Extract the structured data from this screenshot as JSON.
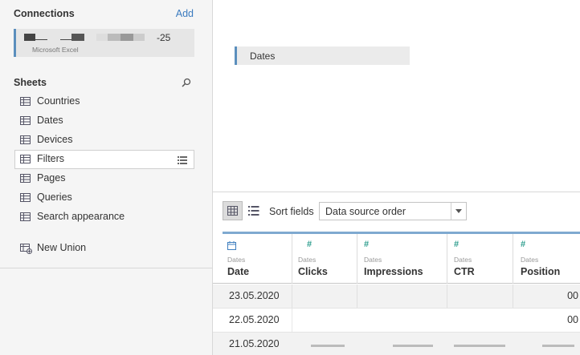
{
  "connections": {
    "title": "Connections",
    "add_label": "Add",
    "item": {
      "name_suffix": "-25",
      "type": "Microsoft Excel"
    }
  },
  "sheets": {
    "title": "Sheets",
    "items": [
      {
        "label": "Countries"
      },
      {
        "label": "Dates"
      },
      {
        "label": "Devices"
      },
      {
        "label": "Filters"
      },
      {
        "label": "Pages"
      },
      {
        "label": "Queries"
      },
      {
        "label": "Search appearance"
      }
    ],
    "new_union": "New Union"
  },
  "canvas": {
    "table_label": "Dates"
  },
  "toolbar": {
    "sort_label": "Sort fields",
    "sort_value": "Data source order"
  },
  "grid": {
    "columns": [
      {
        "source": "Dates",
        "name": "Date",
        "type": "date"
      },
      {
        "source": "Dates",
        "name": "Clicks",
        "type": "number"
      },
      {
        "source": "Dates",
        "name": "Impressions",
        "type": "number"
      },
      {
        "source": "Dates",
        "name": "CTR",
        "type": "number"
      },
      {
        "source": "Dates",
        "name": "Position",
        "type": "number"
      }
    ],
    "rows": [
      {
        "date": "23.05.2020",
        "position_tail": "00"
      },
      {
        "date": "22.05.2020",
        "position_tail": "00"
      },
      {
        "date": "21.05.2020",
        "position_tail": ""
      }
    ]
  },
  "colors": {
    "accent": "#5b8fbd",
    "link": "#3b7bbf",
    "number_icon": "#2e9e8e",
    "date_icon": "#3f7fbf"
  }
}
